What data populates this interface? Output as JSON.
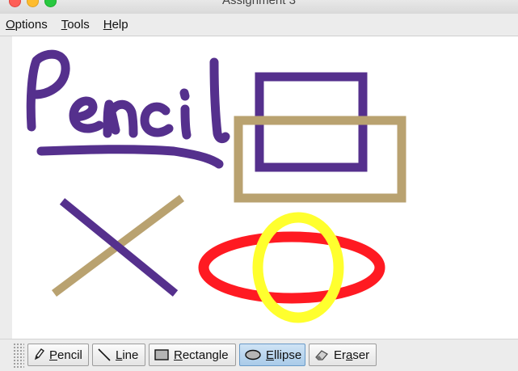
{
  "window": {
    "title": "Assignment 3"
  },
  "menu": {
    "items": [
      {
        "mnemonic": "O",
        "rest": "ptions"
      },
      {
        "mnemonic": "T",
        "rest": "ools"
      },
      {
        "mnemonic": "H",
        "rest": "elp"
      }
    ]
  },
  "colors": {
    "purple": "#55308d",
    "tan": "#b9a270",
    "red": "#ff1a22",
    "yellow": "#ffff2e",
    "active_tool": "#a9cbe9"
  },
  "toolbar": {
    "selected": "Ellipse",
    "tools": [
      {
        "pre": "",
        "mnemonic": "P",
        "post": "encil",
        "icon": "pencil-icon"
      },
      {
        "pre": "",
        "mnemonic": "L",
        "post": "ine",
        "icon": "line-icon"
      },
      {
        "pre": "",
        "mnemonic": "R",
        "post": "ectangle",
        "icon": "rectangle-icon"
      },
      {
        "pre": "",
        "mnemonic": "E",
        "post": "llipse",
        "icon": "ellipse-icon"
      },
      {
        "pre": "Er",
        "mnemonic": "a",
        "post": "ser",
        "icon": "eraser-icon"
      }
    ]
  }
}
